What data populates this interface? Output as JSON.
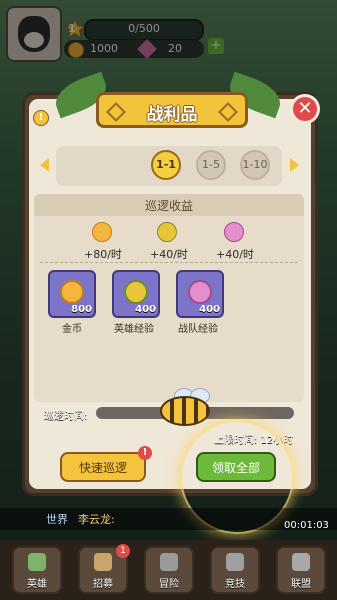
{
  "hud": {
    "level": "1",
    "xp": "0/500",
    "coins": "1000",
    "gems": "20",
    "plus": "+"
  },
  "dialog": {
    "title": "战利品",
    "help": "!",
    "close": "✕",
    "tabs": [
      {
        "label": "1-1",
        "active": true
      },
      {
        "label": "1-5",
        "active": false
      },
      {
        "label": "1-10",
        "active": false
      }
    ],
    "section_title": "巡逻收益",
    "rates": [
      "+80/时",
      "+40/时",
      "+40/时"
    ],
    "items": [
      {
        "name": "金币",
        "count": "800",
        "icon": "crown-coin-icon"
      },
      {
        "name": "英雄经验",
        "count": "400",
        "icon": "potion-icon"
      },
      {
        "name": "战队经验",
        "count": "400",
        "icon": "candy-icon"
      }
    ],
    "patrol_label": "巡逻时间:",
    "patrol_progress": 0.0,
    "limit_text": "上限时间: 12小时",
    "quick_button": "快速巡逻",
    "quick_badge": "!",
    "collect_button": "领取全部"
  },
  "chat": {
    "channel": "世界",
    "name": "李云龙:"
  },
  "timer": "00:01:03",
  "nav": {
    "items": [
      {
        "label": "英雄",
        "badge": ""
      },
      {
        "label": "招募",
        "badge": "1"
      },
      {
        "label": "冒险",
        "badge": ""
      },
      {
        "label": "竞技",
        "badge": ""
      },
      {
        "label": "联盟",
        "badge": ""
      }
    ]
  },
  "colors": {
    "accent": "#f5c43c",
    "green": "#6db93a",
    "red": "#e04a4a",
    "panel": "#efe7d7",
    "item_bg": "#7b74c8"
  }
}
